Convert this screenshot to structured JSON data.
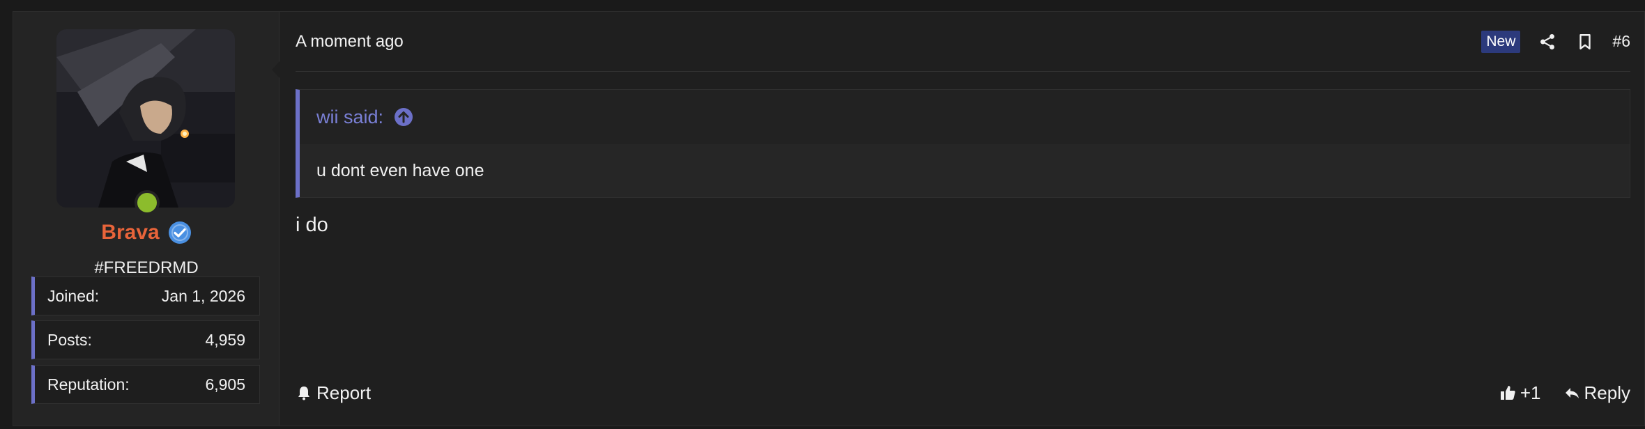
{
  "user": {
    "name": "Brava",
    "title": "#FREEDRMD",
    "online": true,
    "stats": [
      {
        "label": "Joined:",
        "value": "Jan 1, 2026"
      },
      {
        "label": "Posts:",
        "value": "4,959"
      },
      {
        "label": "Reputation:",
        "value": "6,905"
      }
    ]
  },
  "post": {
    "timestamp": "A moment ago",
    "badge": "New",
    "number": "#6",
    "quote": {
      "author_line": "wii said:",
      "text": "u dont even have one"
    },
    "message": "i do"
  },
  "footer": {
    "report_label": "Report",
    "like_label": "+1",
    "reply_label": "Reply"
  },
  "colors": {
    "accent": "#6c70c8",
    "username": "#e8643a",
    "online": "#8cbc2c",
    "verified": "#4a90e2",
    "badge_bg": "#2c3a7c"
  },
  "icons": [
    "verified-icon",
    "share-icon",
    "bookmark-icon",
    "arrow-up-circle-icon",
    "bell-icon",
    "thumbs-up-icon",
    "reply-icon"
  ]
}
